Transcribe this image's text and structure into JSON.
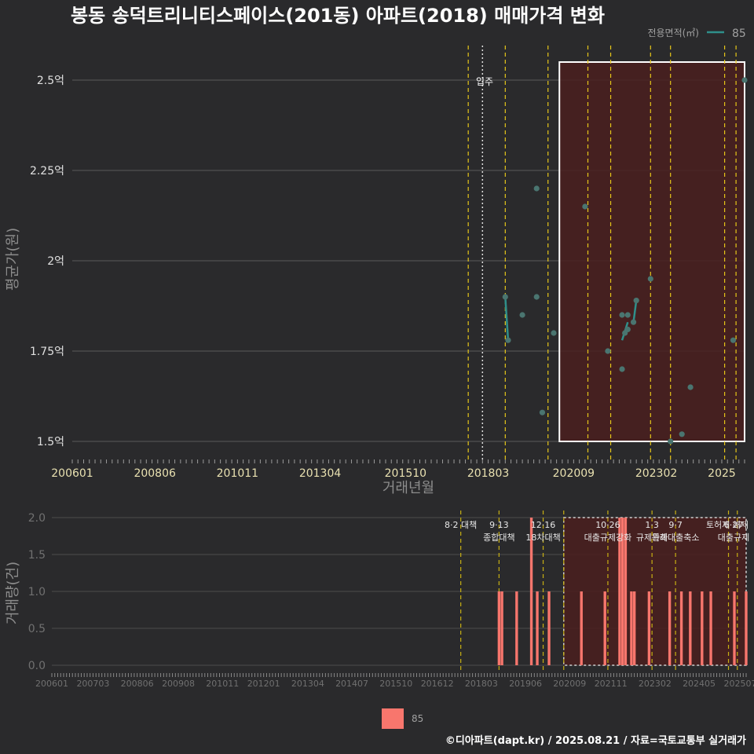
{
  "title": "봉동 송덕트리니티스페이스(201동) 아파트(2018) 매매가격 변화",
  "caption": "©디아파트(dapt.kr) / 2025.08.21 / 자료=국토교통부 실거래가",
  "colors": {
    "background": "#2a2a2c",
    "line": "#2f8f8a",
    "point": "#4a7570",
    "bar": "#f8766d",
    "policy_line": "#e6c619",
    "policy_line_dim": "#c8b013",
    "grid": "#5a5a5a",
    "highlight_fill": "#4a1e1e",
    "highlight_border": "#ffffff"
  },
  "chart_data": [
    {
      "type": "line",
      "title": "봉동 송덕트리니티스페이스(201동) 아파트(2018) 매매가격 변화",
      "xlabel": "거래년월",
      "ylabel": "평균가(원)",
      "ylim": [
        1.45,
        2.6
      ],
      "xlim": [
        "2006-01",
        "2025-09"
      ],
      "y_ticks": [
        1.5,
        1.75,
        2.0,
        2.25,
        2.5
      ],
      "y_tick_labels": [
        "1.5억",
        "1.75억",
        "2억",
        "2.25억",
        "2.5억"
      ],
      "x_ticks": [
        "200601",
        "200806",
        "201011",
        "201304",
        "201510",
        "201803",
        "202009",
        "202302",
        "2025"
      ],
      "legend": {
        "title": "전용면적(㎡)",
        "entries": [
          "85"
        ],
        "position": "top-right"
      },
      "grid": true,
      "annotations": [
        {
          "label": "입주",
          "x": "2018-01"
        }
      ],
      "policy_lines": [
        "2017-08",
        "2018-09",
        "2019-12",
        "2021-02",
        "2021-10",
        "2022-12",
        "2023-07",
        "2025-02",
        "2025-06"
      ],
      "highlight_box": {
        "x_start": "2020-04",
        "x_end": "2025-09",
        "y_start": 1.5,
        "y_end": 2.55
      },
      "series": [
        {
          "name": "85",
          "points": [
            [
              "2018-09",
              1.9
            ],
            [
              "2018-10",
              1.78
            ],
            [
              "2019-03",
              1.85
            ],
            [
              "2019-08",
              1.9
            ],
            [
              "2019-08",
              2.2
            ],
            [
              "2019-10",
              1.58
            ],
            [
              "2020-02",
              1.8
            ],
            [
              "2021-01",
              2.15
            ],
            [
              "2021-09",
              1.75
            ],
            [
              "2022-02",
              1.7
            ],
            [
              "2022-02",
              1.85
            ],
            [
              "2022-03",
              1.8
            ],
            [
              "2022-04",
              1.81
            ],
            [
              "2022-04",
              1.85
            ],
            [
              "2022-06",
              1.83
            ],
            [
              "2022-07",
              1.89
            ],
            [
              "2022-12",
              1.95
            ],
            [
              "2023-07",
              1.5
            ],
            [
              "2023-11",
              1.52
            ],
            [
              "2024-02",
              1.65
            ],
            [
              "2025-05",
              1.78
            ],
            [
              "2025-09",
              2.5
            ]
          ],
          "connected": [
            [
              [
                "2018-09",
                1.9
              ],
              [
                "2018-10",
                1.78
              ]
            ],
            [
              [
                "2022-02",
                1.78
              ],
              [
                "2022-04",
                1.83
              ]
            ],
            [
              [
                "2022-06",
                1.83
              ],
              [
                "2022-07",
                1.89
              ]
            ]
          ]
        }
      ]
    },
    {
      "type": "bar",
      "xlabel": "",
      "ylabel": "거래량(건)",
      "ylim": [
        0,
        2.0
      ],
      "y_ticks": [
        0.0,
        0.5,
        1.0,
        1.5,
        2.0
      ],
      "y_tick_labels": [
        "0.0",
        "0.5",
        "1.0",
        "1.5",
        "2.0"
      ],
      "x_ticks": [
        "200601",
        "200703",
        "200806",
        "200908",
        "201011",
        "201201",
        "201304",
        "201407",
        "201510",
        "201612",
        "201803",
        "201906",
        "202009",
        "202111",
        "202302",
        "202405",
        "202507"
      ],
      "legend": {
        "entries": [
          "85"
        ],
        "position": "bottom"
      },
      "policy_annotations": [
        {
          "x": "2017-08",
          "lines": [
            "8·2 대책"
          ]
        },
        {
          "x": "2018-09",
          "lines": [
            "9·13",
            "종합대책"
          ]
        },
        {
          "x": "2019-12",
          "lines": [
            "12·16",
            "18차대책"
          ]
        },
        {
          "x": "2020-07",
          "lines": []
        },
        {
          "x": "2021-10",
          "lines": [
            "10·26",
            "대출규제강화"
          ]
        },
        {
          "x": "2023-01",
          "lines": [
            "1·3",
            "규제완화"
          ]
        },
        {
          "x": "2023-09",
          "lines": [
            "9·7",
            "특례대출축소"
          ]
        },
        {
          "x": "2025-06",
          "lines": [
            "6·27",
            "대출규제"
          ]
        },
        {
          "x": "2025-03",
          "lines": [
            "토허제 해제"
          ]
        }
      ],
      "highlight_box": {
        "x_start": "2020-07",
        "x_end": "2025-09"
      },
      "series": [
        {
          "name": "85",
          "bars": [
            [
              "2018-09",
              1
            ],
            [
              "2018-10",
              1
            ],
            [
              "2019-03",
              1
            ],
            [
              "2019-08",
              2
            ],
            [
              "2019-10",
              1
            ],
            [
              "2020-02",
              1
            ],
            [
              "2021-01",
              1
            ],
            [
              "2021-09",
              1
            ],
            [
              "2022-02",
              2
            ],
            [
              "2022-03",
              2
            ],
            [
              "2022-04",
              2
            ],
            [
              "2022-06",
              1
            ],
            [
              "2022-07",
              1
            ],
            [
              "2022-12",
              1
            ],
            [
              "2023-07",
              1
            ],
            [
              "2023-11",
              1
            ],
            [
              "2024-02",
              1
            ],
            [
              "2024-06",
              1
            ],
            [
              "2024-09",
              1
            ],
            [
              "2025-05",
              1
            ],
            [
              "2025-09",
              1
            ]
          ]
        }
      ]
    }
  ]
}
